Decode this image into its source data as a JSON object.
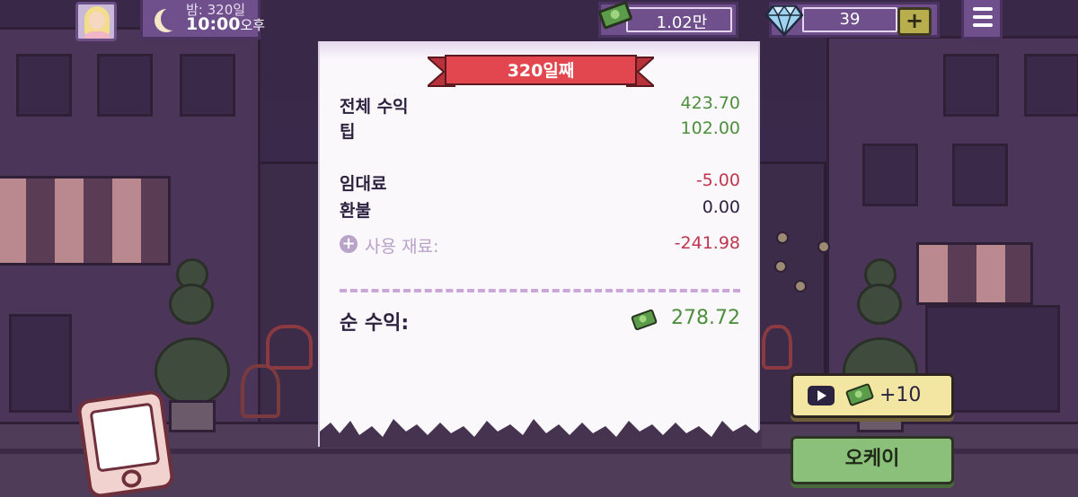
{
  "hud": {
    "time_day": "밤: 320일",
    "time_clock": "10:00",
    "time_ampm": "오후",
    "money": "1.02만",
    "gems": "39",
    "gem_plus": "+"
  },
  "receipt": {
    "day_title": "320일째",
    "rows": [
      {
        "label": "전체 수익",
        "value": "423.70"
      },
      {
        "label": "팁",
        "value": "102.00"
      },
      {
        "label": "임대료",
        "value": "-5.00"
      },
      {
        "label": "환불",
        "value": "0.00"
      },
      {
        "label": "사용 재료:",
        "value": "-241.98"
      }
    ],
    "expand_symbol": "+",
    "net_label": "순 수익:",
    "net_value": "278.72"
  },
  "buttons": {
    "ad_reward": "+10",
    "ok": "오케이"
  },
  "colors": {
    "positive": "#4d8f3c",
    "negative": "#c0364c",
    "ribbon": "#e2474f",
    "ok_button": "#8bc07a",
    "ad_button": "#f3e6a3"
  },
  "icons": [
    "avatar",
    "moon-icon",
    "cash-icon",
    "diamond-icon",
    "plus-icon",
    "menu-icon",
    "play-video-icon",
    "tablet-icon"
  ]
}
